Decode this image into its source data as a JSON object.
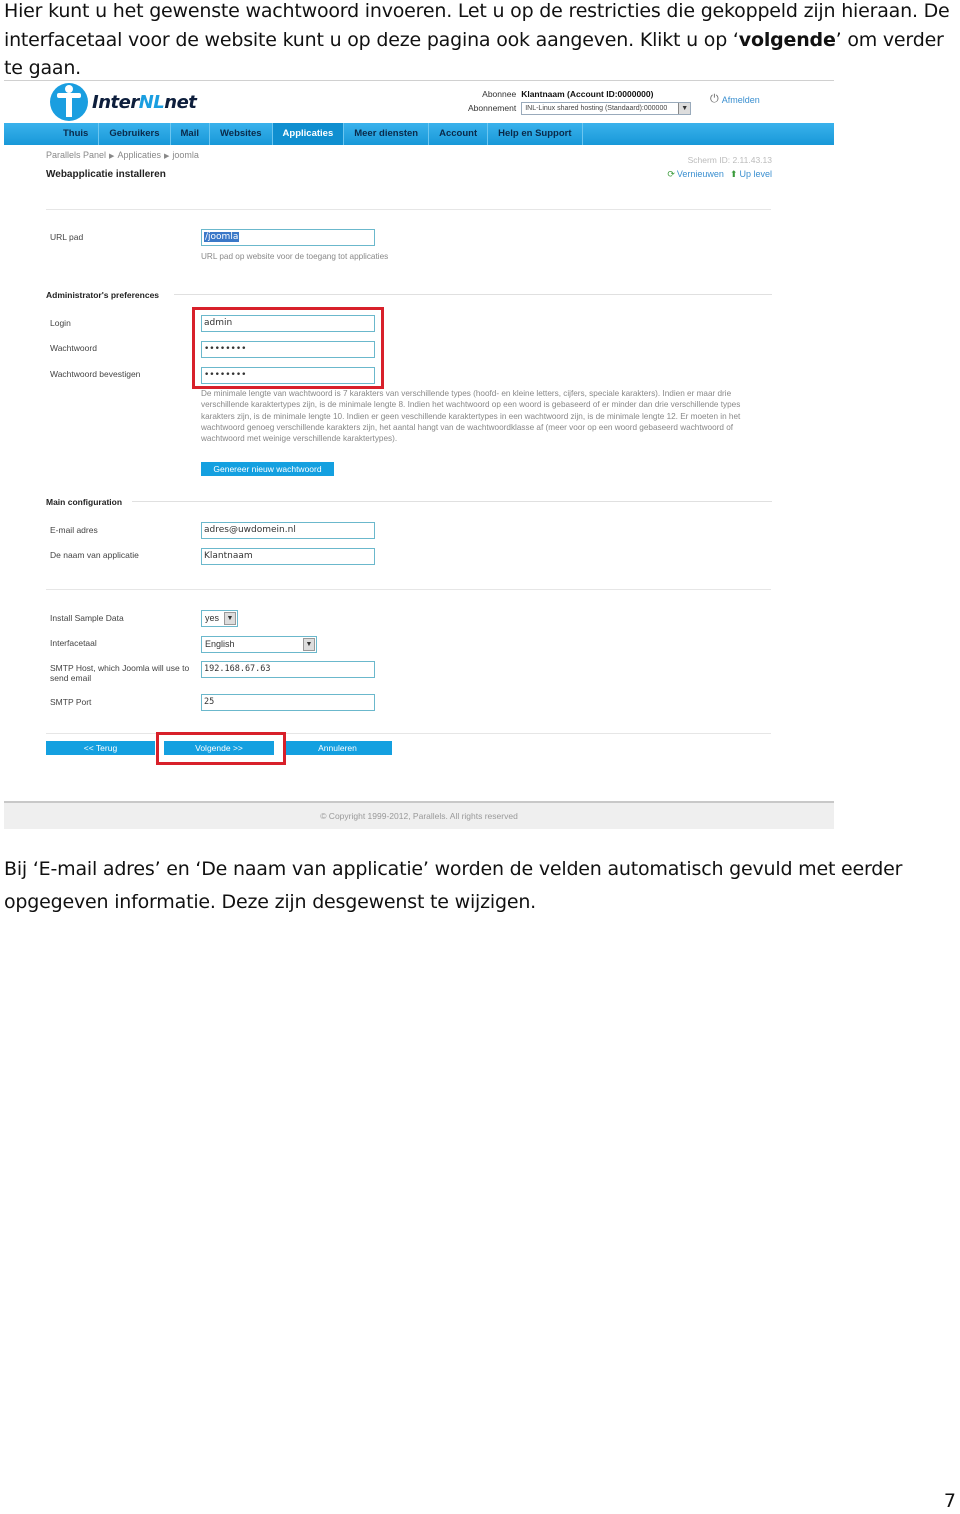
{
  "document": {
    "intro_part1": "Hier kunt u het gewenste wachtwoord invoeren. Let u op de restricties die gekoppeld zijn hieraan. De interfacetaal voor de website kunt u op deze pagina ook aangeven. Klikt u op ‘",
    "intro_bold": "volgende",
    "intro_part2": "’ om verder te gaan.",
    "outro": "Bij ‘E-mail adres’ en ‘De naam van applicatie’ worden de velden automatisch gevuld met eerder opgegeven informatie. Deze zijn desgewenst te wijzigen.",
    "page_number": "7"
  },
  "panel": {
    "logo": {
      "part1": "Inter",
      "part2": "NL",
      "part3": "net"
    },
    "account": {
      "subscriber_label": "Abonnee",
      "subscriber_value": "Klantnaam (Account ID:0000000)",
      "subscription_label": "Abonnement",
      "subscription_value": "INL-Linux shared hosting (Standaard):000000",
      "logout": "Afmelden"
    },
    "nav": [
      {
        "label": "Thuis",
        "active": false
      },
      {
        "label": "Gebruikers",
        "active": false
      },
      {
        "label": "Mail",
        "active": false
      },
      {
        "label": "Websites",
        "active": false
      },
      {
        "label": "Applicaties",
        "active": true
      },
      {
        "label": "Meer diensten",
        "active": false
      },
      {
        "label": "Account",
        "active": false
      },
      {
        "label": "Help en Support",
        "active": false
      }
    ],
    "breadcrumb": [
      "Parallels Panel",
      "Applicaties",
      "joomla"
    ],
    "page_title": "Webapplicatie installeren",
    "screen_id": "Scherm ID:  2.11.43.13",
    "refresh": "Vernieuwen",
    "up_level": "Up level",
    "url": {
      "label": "URL pad",
      "value": "/joomla",
      "help": "URL pad op website voor de toegang tot applicaties"
    },
    "admin": {
      "title": "Administrator's preferences",
      "login_label": "Login",
      "login_value": "admin",
      "password_label": "Wachtwoord",
      "password_value": "••••••••",
      "confirm_label": "Wachtwoord bevestigen",
      "confirm_value": "••••••••",
      "password_help": "De minimale lengte van wachtwoord is 7 karakters van verschillende types (hoofd- en kleine letters, cijfers, speciale karakters). Indien er maar drie verschillende karaktertypes zijn, is de minimale lengte 8. Indien het wachtwoord op een woord is gebaseerd of er minder dan drie verschillende types karakters zijn, is de minimale lengte 10. Indien er geen veschillende karaktertypes in een wachtwoord zijn, is de minimale lengte 12. Er moeten in het wachtwoord genoeg verschillende karakters zijn, het aantal hangt van de wachtwoordklasse af (meer voor op een woord gebaseerd wachtwoord of wachtwoord met weinige verschillende karaktertypes).",
      "generate_button": "Genereer nieuw wachtwoord"
    },
    "main": {
      "title": "Main configuration",
      "email_label": "E-mail adres",
      "email_value": "adres@uwdomein.nl",
      "appname_label": "De naam van applicatie",
      "appname_value": "Klantnaam"
    },
    "extra": {
      "sample_label": "Install Sample Data",
      "sample_value": "yes",
      "language_label": "Interfacetaal",
      "language_value": "English",
      "smtp_host_label": "SMTP Host, which Joomla will use to send email",
      "smtp_host_value": "192.168.67.63",
      "smtp_port_label": "SMTP Port",
      "smtp_port_value": "25"
    },
    "buttons": {
      "back": "<< Terug",
      "next": "Volgende >>",
      "cancel": "Annuleren"
    },
    "footer": "© Copyright 1999-2012, Parallels. All rights reserved",
    "colors": {
      "accent": "#14a0e0",
      "highlight": "#d8202a"
    }
  }
}
